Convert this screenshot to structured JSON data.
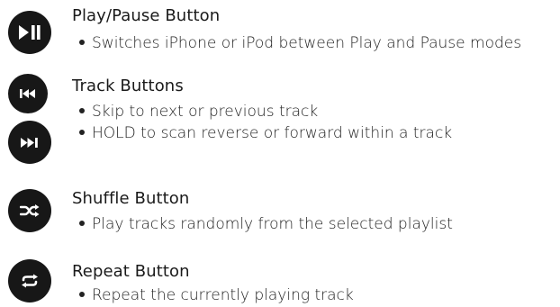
{
  "sections": [
    {
      "title": "Play/Pause  Button",
      "icon": "play-pause-icon",
      "bullets": [
        "Switches iPhone or iPod between Play and Pause modes"
      ]
    },
    {
      "title": "Track  Buttons",
      "icons": [
        "previous-track-icon",
        "next-track-icon"
      ],
      "bullets": [
        "Skip to next or previous track",
        "HOLD to scan reverse or forward within a track"
      ]
    },
    {
      "title": "Shuffle Button",
      "icon": "shuffle-icon",
      "bullets": [
        "Play tracks randomly from the selected playlist"
      ]
    },
    {
      "title": "Repeat Button",
      "icon": "repeat-icon",
      "bullets": [
        "Repeat the currently playing track"
      ]
    }
  ],
  "colors": {
    "button_fill": "#171717",
    "icon": "#ffffff",
    "text": "#1a1a1a"
  }
}
